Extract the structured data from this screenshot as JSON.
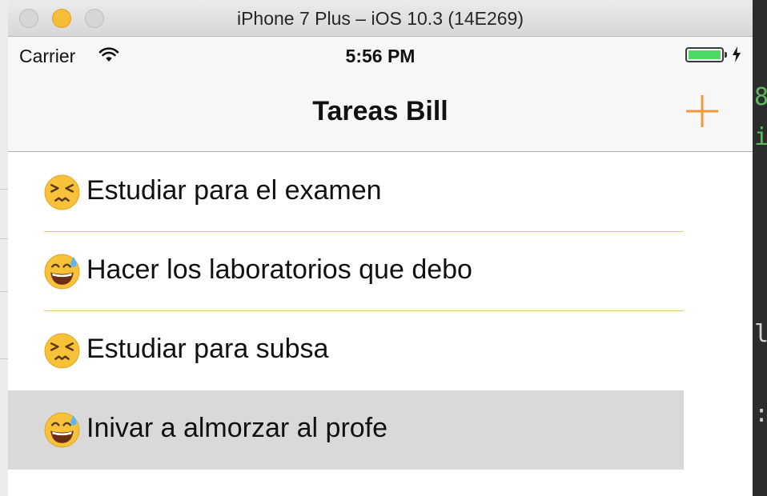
{
  "window": {
    "title": "iPhone 7 Plus – iOS 10.3 (14E269)"
  },
  "status_bar": {
    "carrier": "Carrier",
    "time": "5:56 PM"
  },
  "nav": {
    "title": "Tareas Bill",
    "add_icon": "plus-icon"
  },
  "tasks": [
    {
      "emoji": "persevering-face",
      "text": "Estudiar para el examen"
    },
    {
      "emoji": "grinning-sweat-face",
      "text": "Hacer los laboratorios que debo"
    },
    {
      "emoji": "persevering-face",
      "text": "Estudiar para subsa"
    },
    {
      "emoji": "grinning-sweat-face",
      "text": "Inivar a almorzar al profe"
    }
  ],
  "colors": {
    "accent": "#f19a38",
    "separator": "#e8c97c",
    "selected_row": "#d9d9d9"
  }
}
